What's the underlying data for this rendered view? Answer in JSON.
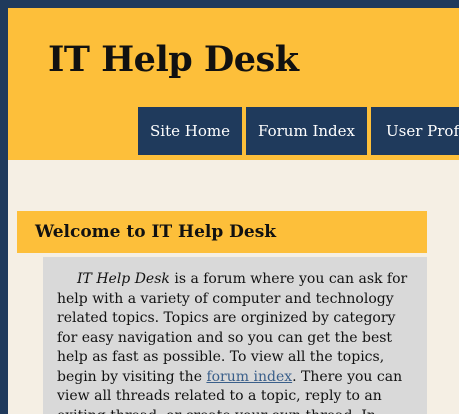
{
  "header": {
    "site_title": "IT Help Desk"
  },
  "nav": {
    "items": [
      {
        "label": "Site Home"
      },
      {
        "label": "Forum Index"
      },
      {
        "label": "User Profile"
      }
    ]
  },
  "main": {
    "section_heading": "Welcome to IT Help Desk",
    "intro": {
      "emphasis": "IT Help Desk",
      "text_before_link": " is a forum where you can ask for help with a variety of computer and technology related topics. Topics are orginized by category for easy navigation and so you can get the best help as fast as possible. To view all the topics, begin by visiting the ",
      "link_text": "forum index",
      "text_after_link": ". There you can view all threads related to a topic, reply to an exiting thread, or create your own thread. In"
    }
  },
  "colors": {
    "brand_yellow": "#fdbf3a",
    "navy": "#1f3a5c",
    "page_background": "#f5efe4",
    "content_box": "#d9d9d9",
    "link": "#3a5f8a"
  }
}
